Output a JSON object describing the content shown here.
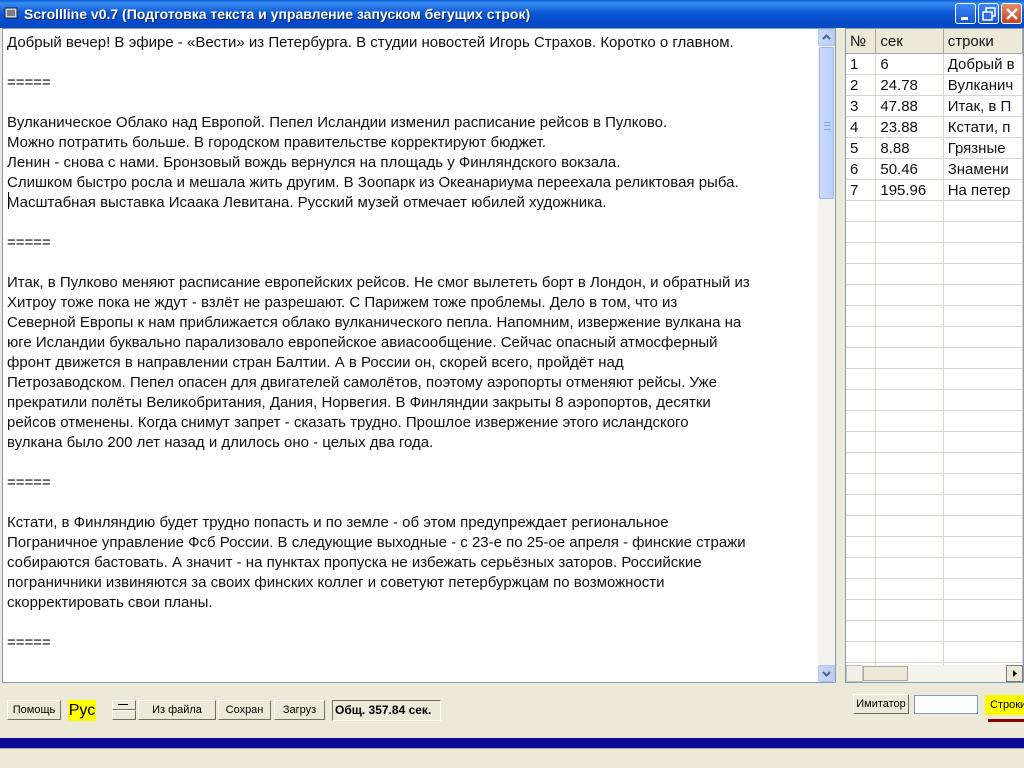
{
  "window": {
    "title": "Scrollline v0.7 (Подготовка текста и управление запуском бегущих строк)"
  },
  "editor": {
    "lines": [
      "Добрый вечер! В эфире - «Вести» из Петербурга. В студии новостей Игорь Страхов. Коротко о главном.",
      "",
      "=====",
      "",
      "Вулканическое Облако над Европой. Пепел Исландии изменил расписание рейсов в Пулково.",
      "Можно потратить больше. В городском правительстве корректируют бюджет.",
      "Ленин - снова с нами. Бронзовый вождь вернулся на площадь у Финляндского вокзала.",
      "Слишком быстро росла и мешала жить другим. В Зоопарк из Океанариума переехала реликтовая рыба.",
      "Масштабная выставка Исаака Левитана. Русский музей отмечает юбилей художника.",
      "",
      "=====",
      "",
      "Итак, в Пулково меняют расписание европейских рейсов. Не смог вылететь борт в Лондон, и обратный из",
      "Хитроу тоже пока не ждут - взлёт не разрешают. С Парижем тоже проблемы. Дело в том, что из",
      "Северной Европы к нам приближается облако вулканического пепла. Напомним, извержение вулкана на",
      "юге Исландии буквально парализовало европейское авиасообщение. Сейчас опасный атмосферный",
      "фронт движется в направлении стран Балтии. А в России он, скорей всего, пройдёт над",
      "Петрозаводском. Пепел опасен для двигателей самолётов, поэтому аэропорты отменяют рейсы. Уже",
      "прекратили полёты Великобритания, Дания, Норвегия. В Финляндии закрыты 8 аэропортов, десятки",
      "рейсов отменены. Когда снимут запрет - сказать трудно. Прошлое извержение этого исландского",
      "вулкана было 200 лет назад и длилось оно - целых два года.",
      "",
      "=====",
      "",
      "Кстати, в Финляндию будет трудно попасть и по земле - об этом предупреждает региональное",
      "Пограничное управление Фсб России. В следующие выходные - с 23-е по 25-ое апреля - финские стражи",
      "собираются бастовать. А значит - на пунктах пропуска не избежать серьёзных заторов. Российские",
      "пограничники извиняются за своих финских коллег и советуют петербуржцам по возможности",
      "скорректировать свои планы.",
      "",
      "====="
    ]
  },
  "grid": {
    "headers": [
      "№",
      "сек",
      "строки"
    ],
    "rows": [
      [
        "1",
        "6",
        "Добрый в"
      ],
      [
        "2",
        "24.78",
        "Вулканич"
      ],
      [
        "3",
        "47.88",
        "Итак, в П"
      ],
      [
        "4",
        "23.88",
        " Кстати, п"
      ],
      [
        "5",
        "8.88",
        " Грязные"
      ],
      [
        "6",
        "50.46",
        "Знамени"
      ],
      [
        "7",
        "195.96",
        "На петер"
      ],
      [
        "",
        "",
        ""
      ],
      [
        "",
        "",
        ""
      ],
      [
        "",
        "",
        ""
      ],
      [
        "",
        "",
        ""
      ],
      [
        "",
        "",
        ""
      ],
      [
        "",
        "",
        ""
      ],
      [
        "",
        "",
        ""
      ],
      [
        "",
        "",
        ""
      ],
      [
        "",
        "",
        ""
      ],
      [
        "",
        "",
        ""
      ],
      [
        "",
        "",
        ""
      ],
      [
        "",
        "",
        ""
      ],
      [
        "",
        "",
        ""
      ],
      [
        "",
        "",
        ""
      ],
      [
        "",
        "",
        ""
      ],
      [
        "",
        "",
        ""
      ],
      [
        "",
        "",
        ""
      ],
      [
        "",
        "",
        ""
      ],
      [
        "",
        "",
        ""
      ],
      [
        "",
        "",
        ""
      ],
      [
        "",
        "",
        ""
      ],
      [
        "",
        "",
        ""
      ],
      [
        "",
        "",
        ""
      ]
    ]
  },
  "toolbar": {
    "help": "Помощь",
    "lang": "Рус",
    "from_file": "Из файла",
    "save": "Сохран",
    "load": "Загруз",
    "total": "Общ. 357.84 сек."
  },
  "right_toolbar": {
    "imitator": "Имитатор",
    "lines_button": "Строки"
  },
  "colors": {
    "highlight": "#ffff00",
    "titlebar": "#0a5fd8",
    "band": "#0a0a96"
  }
}
